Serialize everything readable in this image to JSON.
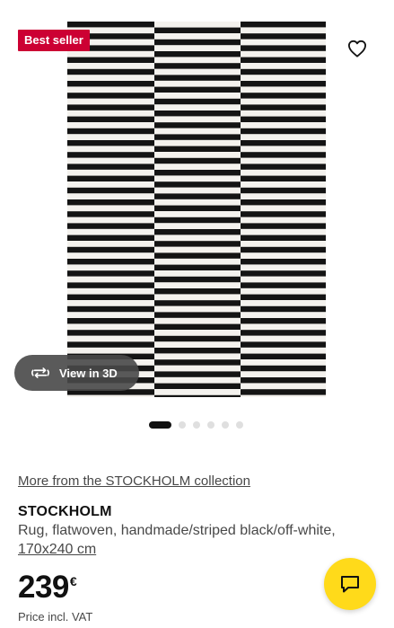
{
  "gallery": {
    "badge": "Best seller",
    "view_3d_label": "View in 3D",
    "active_slide": 0,
    "slide_count": 6,
    "rug_colors": {
      "dark": "#141414",
      "light": "#f4f2ee"
    }
  },
  "icons": {
    "favorite": "heart-outline-icon",
    "view_3d": "rotate-3d-icon",
    "chat": "chat-bubble-icon"
  },
  "product": {
    "collection_link": "More from the STOCKHOLM collection",
    "name": "STOCKHOLM",
    "description": "Rug, flatwoven, handmade/striped black/off-white,",
    "size": "170x240 cm",
    "price_integer": "239",
    "price_currency": "€",
    "price_note": "Price incl. VAT"
  },
  "colors": {
    "badge_bg": "#cc0033",
    "chat_bg": "#ffda1a"
  }
}
